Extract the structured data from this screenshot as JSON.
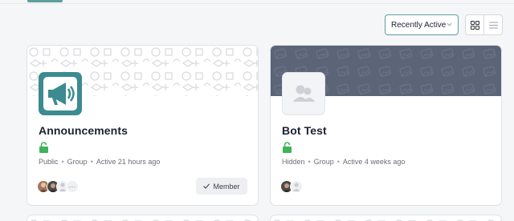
{
  "sort": {
    "selected": "Recently Active"
  },
  "view_toggle": {
    "grid_icon": "grid-icon",
    "list_icon": "list-icon",
    "active": "grid"
  },
  "groups": [
    {
      "name": "Announcements",
      "privacy_icon": "unlocked-icon",
      "privacy": "Public",
      "type": "Group",
      "activity": "Active 21 hours ago",
      "avatar_icon": "megaphone-icon",
      "member_status": "Member",
      "member_status_icon": "check-icon",
      "more_members_label": "···"
    },
    {
      "name": "Bot Test",
      "privacy_icon": "unlocked-icon",
      "privacy": "Hidden",
      "type": "Group",
      "activity": "Active 4 weeks ago",
      "avatar_icon": "group-placeholder-icon"
    }
  ],
  "colors": {
    "accent": "#5e9e9b",
    "lock": "#3fb35a",
    "cover_dark": "#5b6577",
    "avatar_teal": "#3b8b91"
  },
  "separator": "•"
}
